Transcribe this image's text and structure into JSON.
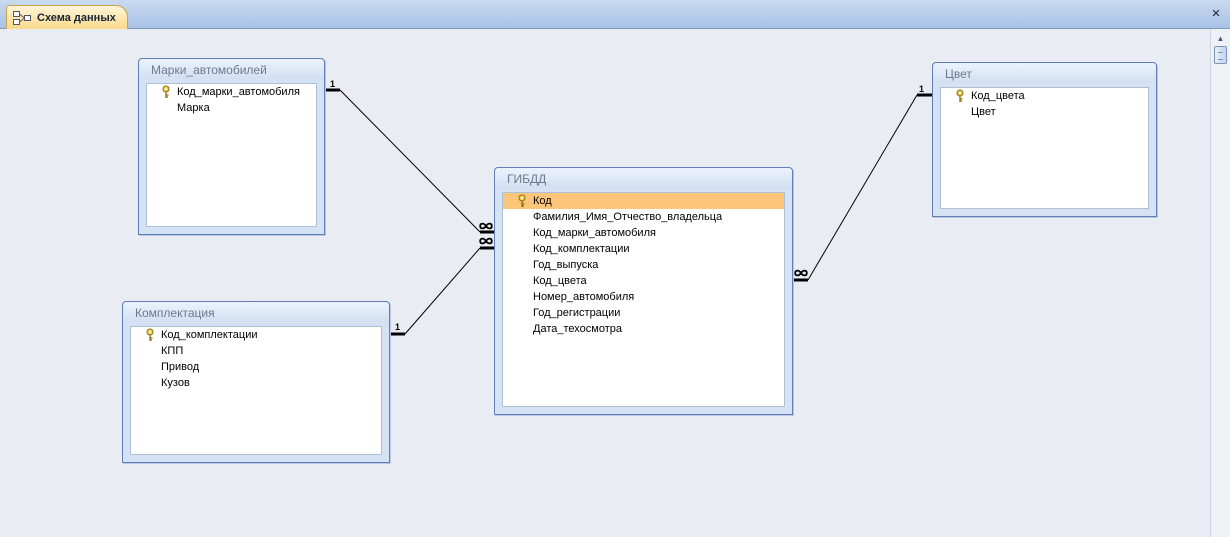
{
  "window": {
    "tab_title": "Схема данных",
    "close_glyph": "×"
  },
  "icons": {
    "tab": "relationships-icon",
    "key": "primary-key-icon",
    "infinity": "infinity-icon"
  },
  "colors": {
    "selected_row": "#fbc57a",
    "table_frame": "#5f7fb6",
    "tab_fill": "#fbd98a"
  },
  "tables": {
    "marki": {
      "title": "Марки_автомобилей",
      "fields": [
        "Код_марки_автомобиля",
        "Марка"
      ],
      "key_index": 0
    },
    "komplektaciya": {
      "title": "Комплектация",
      "fields": [
        "Код_комплектации",
        "КПП",
        "Привод",
        "Кузов"
      ],
      "key_index": 0
    },
    "gibdd": {
      "title": "ГИБДД",
      "fields": [
        "Код",
        "Фамилия_Имя_Отчество_владельца",
        "Код_марки_автомобиля",
        "Код_комплектации",
        "Год_выпуска",
        "Код_цвета",
        "Номер_автомобиля",
        "Год_регистрации",
        "Дата_техосмотра"
      ],
      "key_index": 0,
      "selected_index": 0
    },
    "cvet": {
      "title": "Цвет",
      "fields": [
        "Код_цвета",
        "Цвет"
      ],
      "key_index": 0
    }
  },
  "relationships": [
    {
      "from": "Марки_автомобилей",
      "to": "ГИБДД",
      "one": "1",
      "many": "∞"
    },
    {
      "from": "Комплектация",
      "to": "ГИБДД",
      "one": "1",
      "many": "∞"
    },
    {
      "from": "Цвет",
      "to": "ГИБДД",
      "one": "1",
      "many": "∞"
    }
  ]
}
